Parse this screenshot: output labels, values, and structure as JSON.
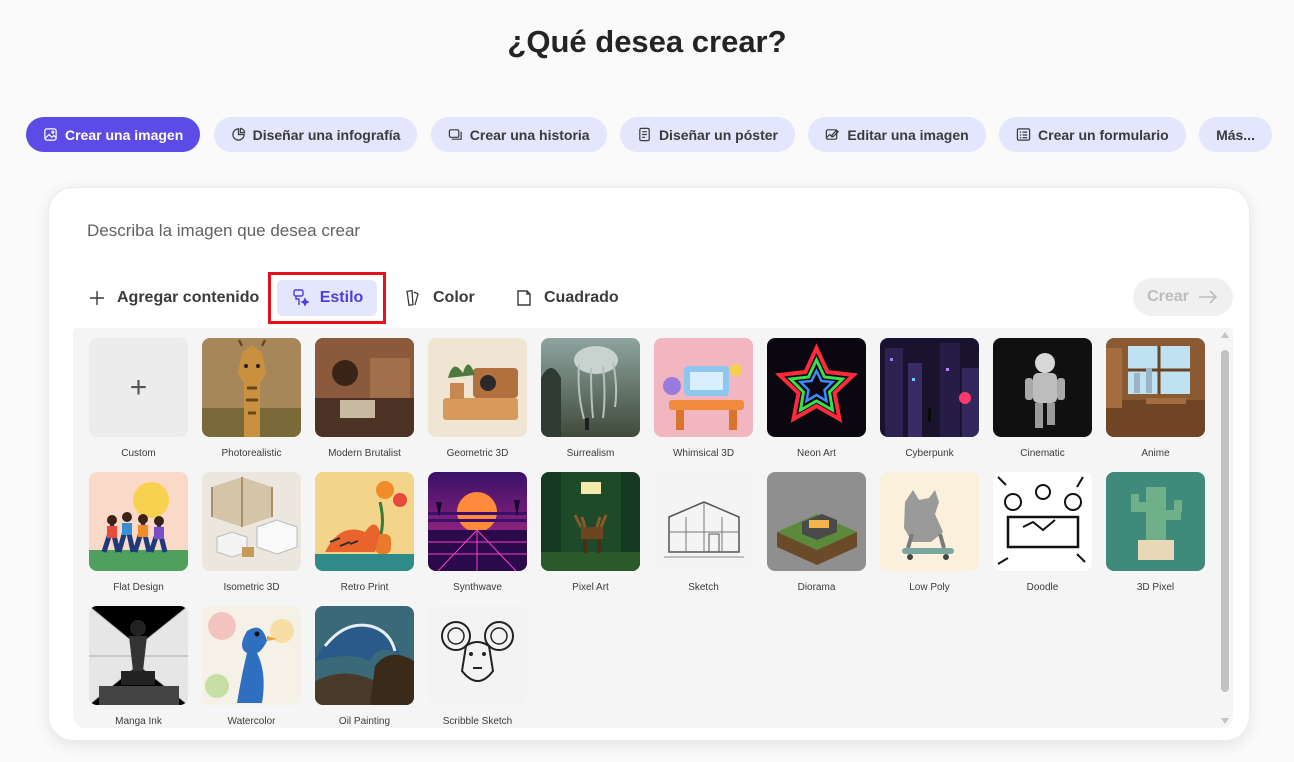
{
  "title": "¿Qué desea crear?",
  "chips": [
    {
      "label": "Crear una imagen",
      "icon": "image-icon",
      "active": true
    },
    {
      "label": "Diseñar una infografía",
      "icon": "infographic-icon",
      "active": false
    },
    {
      "label": "Crear una historia",
      "icon": "story-icon",
      "active": false
    },
    {
      "label": "Diseñar un póster",
      "icon": "poster-icon",
      "active": false
    },
    {
      "label": "Editar una imagen",
      "icon": "edit-image-icon",
      "active": false
    },
    {
      "label": "Crear un formulario",
      "icon": "form-icon",
      "active": false
    },
    {
      "label": "Más...",
      "icon": "",
      "active": false
    }
  ],
  "prompt": {
    "placeholder": "Describa la imagen que desea crear",
    "value": ""
  },
  "toolbar": {
    "add_content": "Agregar contenido",
    "style": "Estilo",
    "color": "Color",
    "aspect": "Cuadrado",
    "create": "Crear"
  },
  "styles": [
    "Custom",
    "Photorealistic",
    "Modern Brutalist",
    "Geometric 3D",
    "Surrealism",
    "Whimsical 3D",
    "Neon Art",
    "Cyberpunk",
    "Cinematic",
    "Anime",
    "Flat Design",
    "Isometric 3D",
    "Retro Print",
    "Synthwave",
    "Pixel Art",
    "Sketch",
    "Diorama",
    "Low Poly",
    "Doodle",
    "3D Pixel",
    "Manga Ink",
    "Watercolor",
    "Oil Painting",
    "Scribble Sketch"
  ],
  "colors": {
    "accent": "#5b4be7",
    "chip_bg": "#e3e6fd",
    "highlight_border": "#e8101a"
  }
}
